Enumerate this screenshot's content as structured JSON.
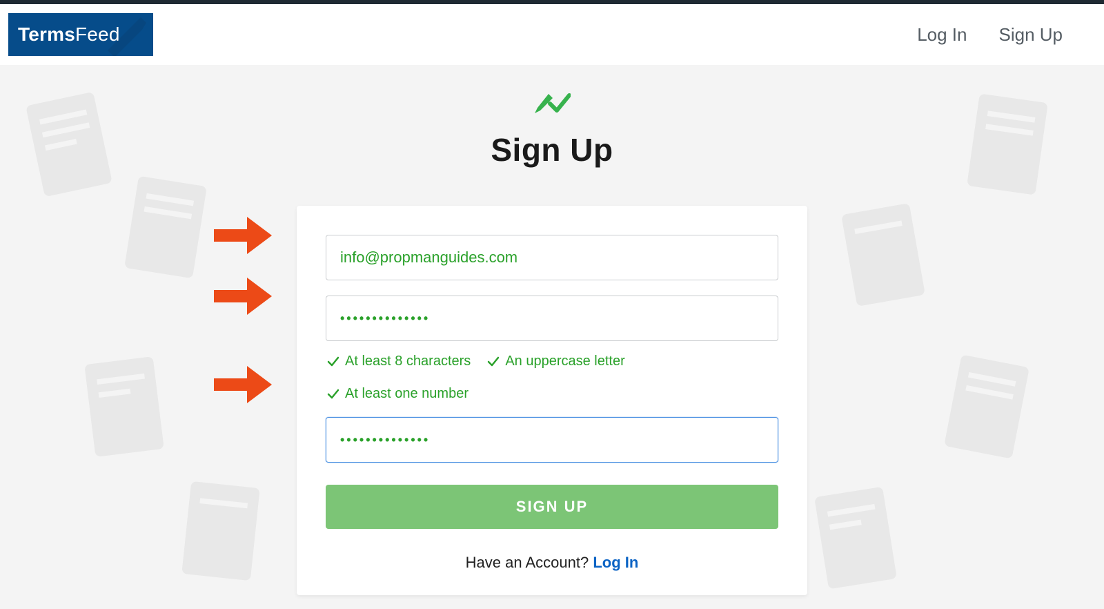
{
  "brand": {
    "name_bold": "Terms",
    "name_light": "Feed"
  },
  "header_nav": {
    "login": "Log In",
    "signup": "Sign Up"
  },
  "page": {
    "title": "Sign Up"
  },
  "form": {
    "email_value": "info@propmanguides.com",
    "password_mask": "••••••••••••••",
    "confirm_mask": "••••••••••••••",
    "requirements": {
      "r1": "At least 8 characters",
      "r2": "An uppercase letter",
      "r3": "At least one number"
    },
    "submit_label": "SIGN UP",
    "have_account_prefix": "Have an Account? ",
    "have_account_link": "Log In"
  },
  "colors": {
    "brand_blue": "#064c8a",
    "valid_green": "#2aa12a",
    "button_green": "#7cc576",
    "focus_blue": "#4a90e2",
    "arrow_orange": "#ec4a17"
  }
}
